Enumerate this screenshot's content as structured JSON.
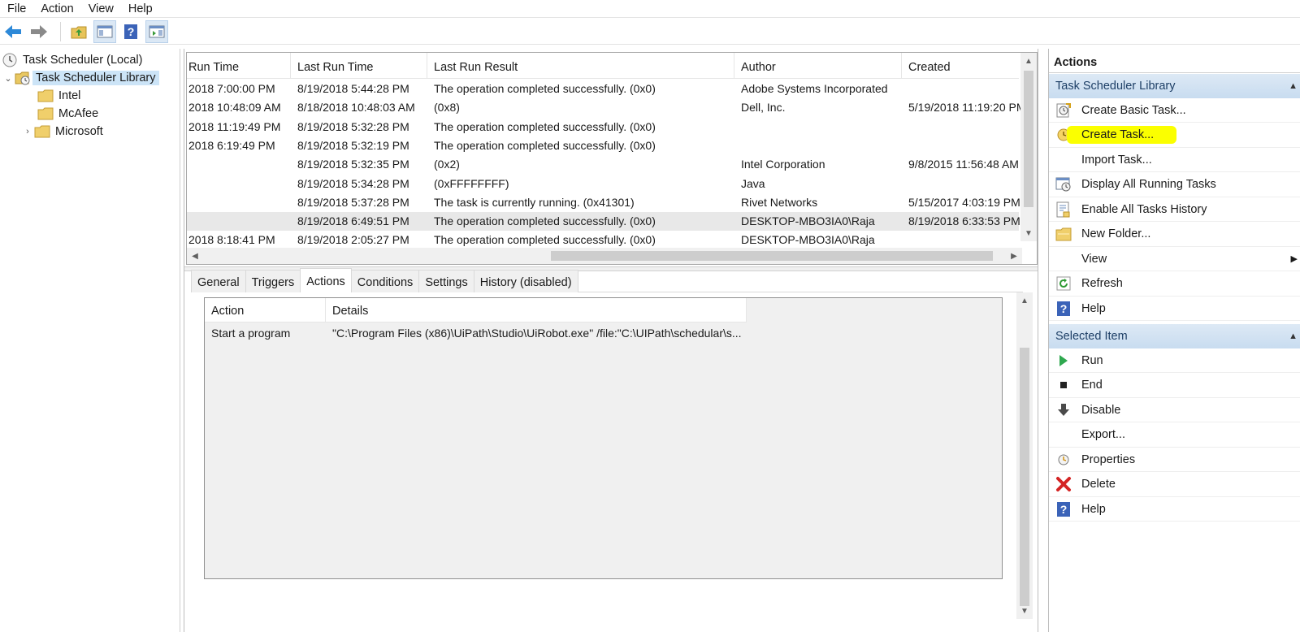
{
  "menu": [
    "File",
    "Action",
    "View",
    "Help"
  ],
  "toolbar": {
    "icons": [
      "back-arrow-icon",
      "forward-arrow-icon",
      "up-folder-icon",
      "show-hide-console-tree-icon",
      "help-icon",
      "show-hide-action-pane-icon"
    ]
  },
  "tree": {
    "root": "Task Scheduler (Local)",
    "library": "Task Scheduler Library",
    "folders": [
      "Intel",
      "McAfee",
      "Microsoft"
    ]
  },
  "tasks": {
    "columns": [
      "Run Time",
      "Last Run Time",
      "Last Run Result",
      "Author",
      "Created"
    ],
    "rows": [
      [
        "2018 7:00:00 PM",
        "8/19/2018 5:44:28 PM",
        "The operation completed successfully. (0x0)",
        "Adobe Systems Incorporated",
        ""
      ],
      [
        "2018 10:48:09 AM",
        "8/18/2018 10:48:03 AM",
        "(0x8)",
        "Dell, Inc.",
        "5/19/2018 11:19:20 PM"
      ],
      [
        "2018 11:19:49 PM",
        "8/19/2018 5:32:28 PM",
        "The operation completed successfully. (0x0)",
        "",
        ""
      ],
      [
        "2018 6:19:49 PM",
        "8/19/2018 5:32:19 PM",
        "The operation completed successfully. (0x0)",
        "",
        ""
      ],
      [
        "",
        "8/19/2018 5:32:35 PM",
        "(0x2)",
        "Intel Corporation",
        "9/8/2015 11:56:48 AM"
      ],
      [
        "",
        "8/19/2018 5:34:28 PM",
        "(0xFFFFFFFF)",
        "Java",
        ""
      ],
      [
        "",
        "8/19/2018 5:37:28 PM",
        "The task is currently running. (0x41301)",
        "Rivet Networks",
        "5/15/2017 4:03:19 PM"
      ],
      [
        "",
        "8/19/2018 6:49:51 PM",
        "The operation completed successfully. (0x0)",
        "DESKTOP-MBO3IA0\\Raja",
        "8/19/2018 6:33:53 PM"
      ],
      [
        "2018 8:18:41 PM",
        "8/19/2018 2:05:27 PM",
        "The operation completed successfully. (0x0)",
        "DESKTOP-MBO3IA0\\Raja",
        ""
      ]
    ]
  },
  "tabs": [
    "General",
    "Triggers",
    "Actions",
    "Conditions",
    "Settings",
    "History (disabled)"
  ],
  "active_tab": "Actions",
  "detail": {
    "columns": [
      "Action",
      "Details"
    ],
    "rows": [
      [
        "Start a program",
        "\"C:\\Program Files (x86)\\UiPath\\Studio\\UiRobot.exe\" /file:\"C:\\UIPath\\schedular\\s..."
      ]
    ]
  },
  "actions_pane": {
    "title": "Actions",
    "section1": "Task Scheduler Library",
    "section1_items": [
      {
        "label": "Create Basic Task...",
        "icon": "create-basic-task-icon"
      },
      {
        "label": "Create Task...",
        "icon": "create-task-icon"
      },
      {
        "label": "Import Task...",
        "icon": ""
      },
      {
        "label": "Display All Running Tasks",
        "icon": "running-tasks-icon"
      },
      {
        "label": "Enable All Tasks History",
        "icon": "tasks-history-icon"
      },
      {
        "label": "New Folder...",
        "icon": "new-folder-icon"
      },
      {
        "label": "View",
        "icon": ""
      },
      {
        "label": "Refresh",
        "icon": "refresh-icon"
      },
      {
        "label": "Help",
        "icon": "help-icon"
      }
    ],
    "section2": "Selected Item",
    "section2_items": [
      {
        "label": "Run",
        "icon": "run-icon"
      },
      {
        "label": "End",
        "icon": "end-icon"
      },
      {
        "label": "Disable",
        "icon": "disable-icon"
      },
      {
        "label": "Export...",
        "icon": ""
      },
      {
        "label": "Properties",
        "icon": "properties-icon"
      },
      {
        "label": "Delete",
        "icon": "delete-icon"
      },
      {
        "label": "Help",
        "icon": "help-icon"
      }
    ]
  },
  "colors": {
    "highlight": "#fbff00",
    "selection": "#cce4f7",
    "section_header": "#c8dcf0"
  }
}
